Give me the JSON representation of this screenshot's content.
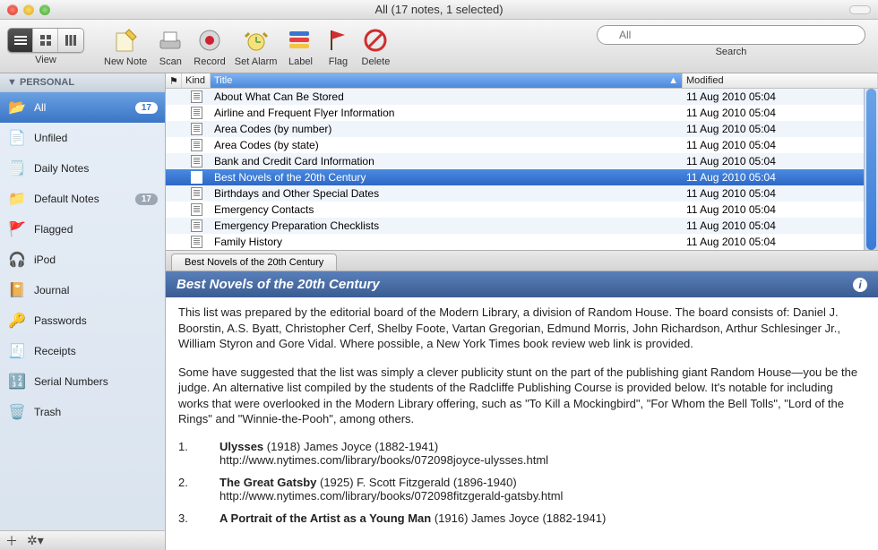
{
  "window": {
    "title": "All (17 notes, 1 selected)"
  },
  "toolbar": {
    "view": "View",
    "new_note": "New Note",
    "scan": "Scan",
    "record": "Record",
    "set_alarm": "Set Alarm",
    "label": "Label",
    "flag": "Flag",
    "delete": "Delete",
    "search_label": "Search",
    "search_placeholder": "All"
  },
  "sidebar": {
    "header": "▼ PERSONAL",
    "items": [
      {
        "icon": "📂",
        "label": "All",
        "badge": "17",
        "selected": true
      },
      {
        "icon": "📄",
        "label": "Unfiled"
      },
      {
        "icon": "🗒️",
        "label": "Daily Notes"
      },
      {
        "icon": "📁",
        "label": "Default Notes",
        "badge": "17"
      },
      {
        "icon": "🚩",
        "label": "Flagged"
      },
      {
        "icon": "🎧",
        "label": "iPod"
      },
      {
        "icon": "📔",
        "label": "Journal"
      },
      {
        "icon": "🔑",
        "label": "Passwords"
      },
      {
        "icon": "🧾",
        "label": "Receipts"
      },
      {
        "icon": "🔢",
        "label": "Serial Numbers"
      },
      {
        "icon": "🗑️",
        "label": "Trash"
      }
    ]
  },
  "columns": {
    "flag": "⚑",
    "kind": "Kind",
    "title": "Title",
    "modified": "Modified"
  },
  "notes": [
    {
      "title": "About What Can Be Stored",
      "mod": "11 Aug 2010 05:04"
    },
    {
      "title": "Airline and Frequent Flyer Information",
      "mod": "11 Aug 2010 05:04"
    },
    {
      "title": "Area Codes (by number)",
      "mod": "11 Aug 2010 05:04"
    },
    {
      "title": "Area Codes (by state)",
      "mod": "11 Aug 2010 05:04"
    },
    {
      "title": "Bank and Credit Card Information",
      "mod": "11 Aug 2010 05:04"
    },
    {
      "title": "Best Novels of the 20th Century",
      "mod": "11 Aug 2010 05:04",
      "selected": true
    },
    {
      "title": "Birthdays and Other Special Dates",
      "mod": "11 Aug 2010 05:04"
    },
    {
      "title": "Emergency Contacts",
      "mod": "11 Aug 2010 05:04"
    },
    {
      "title": "Emergency Preparation Checklists",
      "mod": "11 Aug 2010 05:04"
    },
    {
      "title": "Family History",
      "mod": "11 Aug 2010 05:04"
    }
  ],
  "tab": {
    "label": "Best Novels of the 20th Century"
  },
  "note": {
    "title": "Best Novels of the 20th Century",
    "p1": "This list was prepared by the editorial board of the Modern Library, a division of Random House. The board consists of: Daniel J. Boorstin, A.S. Byatt, Christopher Cerf, Shelby Foote, Vartan Gregorian, Edmund Morris, John Richardson, Arthur Schlesinger Jr., William Styron and Gore Vidal. Where possible, a New York Times book review web link is provided.",
    "p2": "Some have suggested that the list was simply a clever publicity stunt on the part of the publishing giant Random House—you be the judge. An alternative list compiled by the students of the Radcliffe Publishing Course is provided below. It's notable for including works that were overlooked in the Modern Library offering, such as \"To Kill a Mockingbird\", \"For Whom the Bell Tolls\", \"Lord of the Rings\" and \"Winnie-the-Pooh\", among others.",
    "entries": [
      {
        "n": "1.",
        "t": "Ulysses",
        "rest": " (1918) James Joyce (1882-1941)",
        "link": "http://www.nytimes.com/library/books/072098joyce-ulysses.html"
      },
      {
        "n": "2.",
        "t": "The Great Gatsby",
        "rest": " (1925) F. Scott Fitzgerald (1896-1940)",
        "link": "http://www.nytimes.com/library/books/072098fitzgerald-gatsby.html"
      },
      {
        "n": "3.",
        "t": "A Portrait of the Artist as a Young Man",
        "rest": " (1916) James Joyce (1882-1941)",
        "link": ""
      }
    ]
  }
}
